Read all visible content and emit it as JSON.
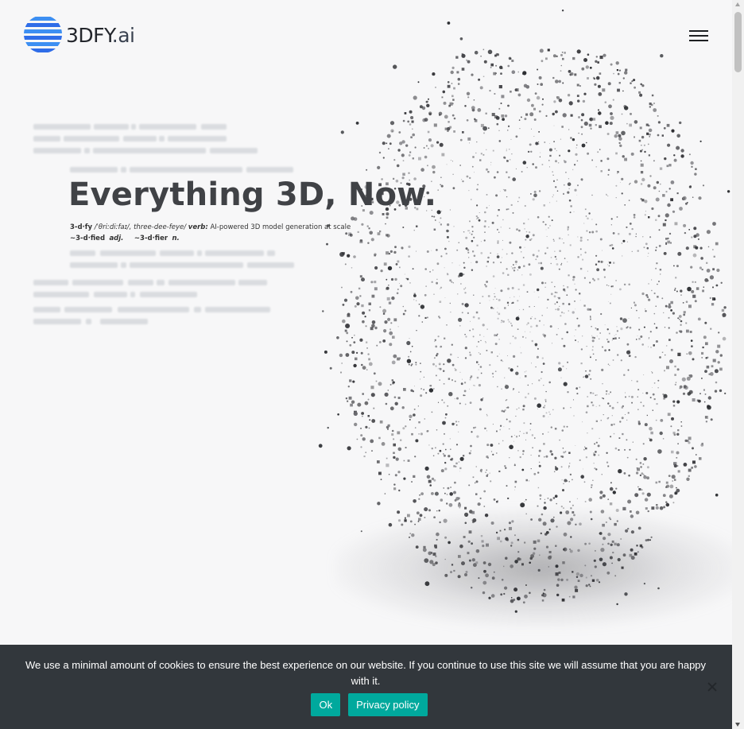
{
  "brand": {
    "name_main": "3DFY",
    "name_suffix": ".ai",
    "colors": {
      "logo_blue": "#2f6de8",
      "logo_light_blue": "#3d8ff2",
      "teal_button": "#00a99d",
      "cookie_bg": "#32373c"
    }
  },
  "header": {
    "menu_icon": "hamburger-menu-icon"
  },
  "hero": {
    "title": "Everything 3D, Now.",
    "definition": {
      "word": "3-d·fy",
      "pronunciation": "/ˈθriːdiːfaɪ/, three-dee-feye/",
      "pos": "verb:",
      "meaning": "AI-powered 3D model generation at scale",
      "derived_1_word": "~3-d·fied",
      "derived_1_pos": "adj.",
      "derived_2_word": "~3-d·fier",
      "derived_2_pos": "n."
    }
  },
  "cookie_notice": {
    "text": "We use a minimal amount of cookies to ensure the best experience on our website. If you continue to use this site we will assume that you are happy with it.",
    "ok_label": "Ok",
    "privacy_label": "Privacy policy",
    "close_icon": "close-icon"
  }
}
